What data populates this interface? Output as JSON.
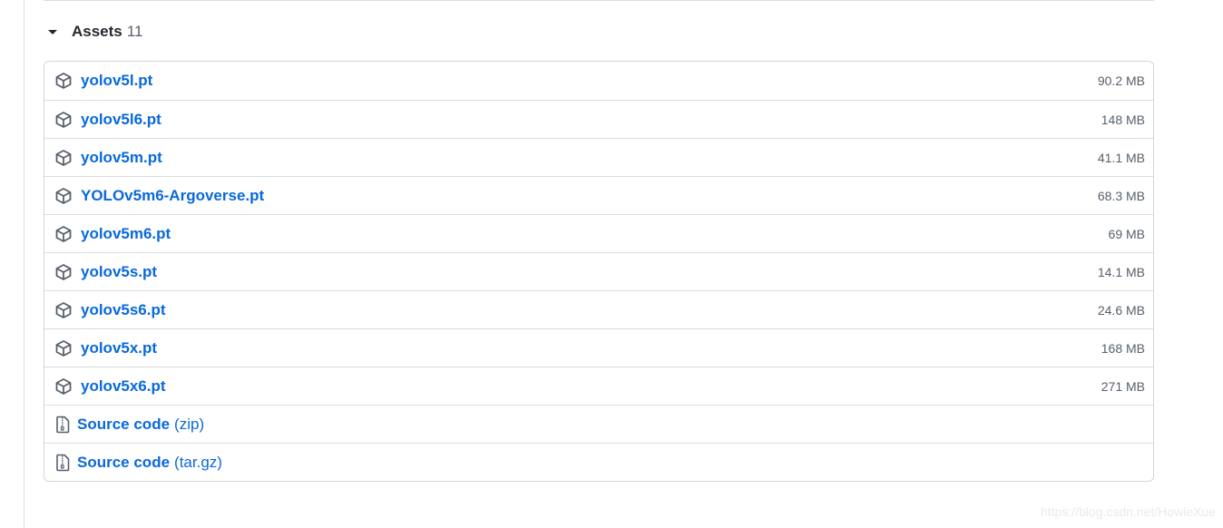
{
  "assets": {
    "title": "Assets",
    "count": "11",
    "files": [
      {
        "name": "yolov5l.pt",
        "size": "90.2 MB"
      },
      {
        "name": "yolov5l6.pt",
        "size": "148 MB"
      },
      {
        "name": "yolov5m.pt",
        "size": "41.1 MB"
      },
      {
        "name": "YOLOv5m6-Argoverse.pt",
        "size": "68.3 MB"
      },
      {
        "name": "yolov5m6.pt",
        "size": "69 MB"
      },
      {
        "name": "yolov5s.pt",
        "size": "14.1 MB"
      },
      {
        "name": "yolov5s6.pt",
        "size": "24.6 MB"
      },
      {
        "name": "yolov5x.pt",
        "size": "168 MB"
      },
      {
        "name": "yolov5x6.pt",
        "size": "271 MB"
      }
    ],
    "sources": [
      {
        "label": "Source code",
        "type": "(zip)"
      },
      {
        "label": "Source code",
        "type": "(tar.gz)"
      }
    ]
  },
  "icons": {
    "file": "package-icon",
    "source": "file-zip-icon",
    "toggle": "caret-down-icon"
  },
  "colors": {
    "link": "#0969da",
    "text": "#24292f",
    "muted": "#57606a",
    "border": "#d0d7de"
  },
  "watermark": "https://blog.csdn.net/HowieXue"
}
